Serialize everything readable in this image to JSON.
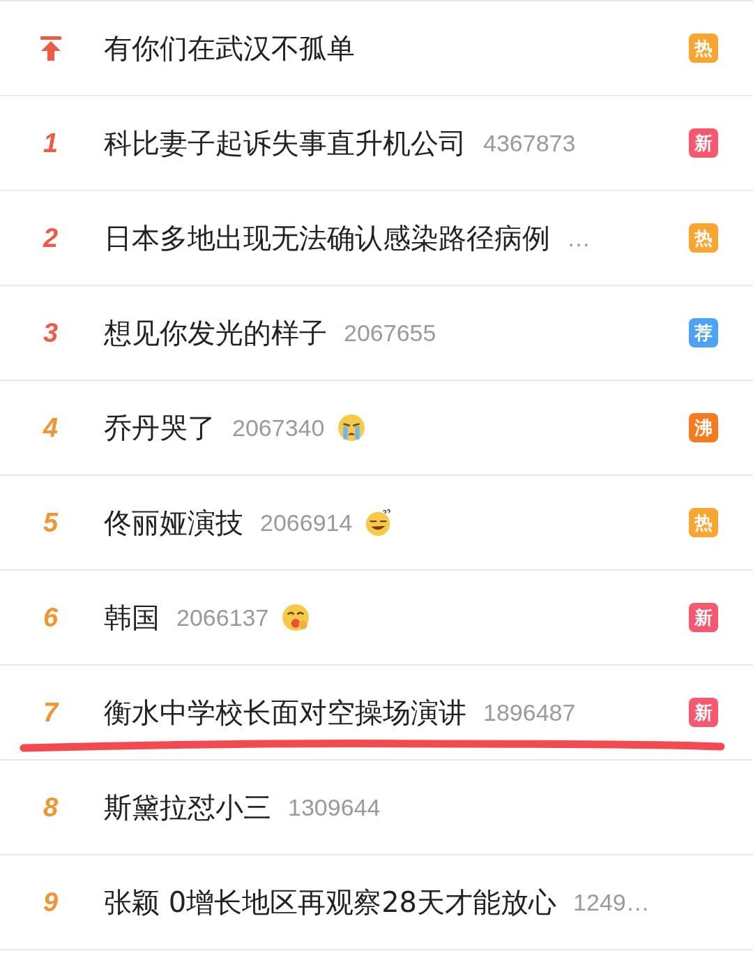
{
  "hot_list": [
    {
      "kind": "pinned",
      "title": "有你们在武汉不孤单",
      "badge": {
        "label": "热",
        "color": "#f9a531"
      }
    },
    {
      "kind": "ranked",
      "rank": "1",
      "color": "#ee5a46",
      "title": "科比妻子起诉失事直升机公司",
      "count": "4367873",
      "badge": {
        "label": "新",
        "color": "#f5596f"
      }
    },
    {
      "kind": "ranked",
      "rank": "2",
      "color": "#ee5a46",
      "title": "日本多地出现无法确认感染路径病例",
      "count": "…",
      "badge": {
        "label": "热",
        "color": "#f9a531"
      }
    },
    {
      "kind": "ranked",
      "rank": "3",
      "color": "#ee5a46",
      "title": "想见你发光的样子",
      "count": "2067655",
      "badge": {
        "label": "荐",
        "color": "#4ea2f5"
      }
    },
    {
      "kind": "ranked",
      "rank": "4",
      "color": "#f19532",
      "title": "乔丹哭了",
      "count": "2067340",
      "emoji": {
        "kind": "crying"
      },
      "badge": {
        "label": "沸",
        "color": "#f67a1f"
      }
    },
    {
      "kind": "ranked",
      "rank": "5",
      "color": "#f19532",
      "title": "佟丽娅演技",
      "count": "2066914",
      "emoji": {
        "kind": "dizzy"
      },
      "badge": {
        "label": "热",
        "color": "#f9a531"
      }
    },
    {
      "kind": "ranked",
      "rank": "6",
      "color": "#f19532",
      "title": "韩国",
      "count": "2066137",
      "emoji": {
        "kind": "yum"
      },
      "badge": {
        "label": "新",
        "color": "#f5596f"
      }
    },
    {
      "kind": "ranked",
      "rank": "7",
      "color": "#f19532",
      "title": "衡水中学校长面对空操场演讲",
      "count": "1896487",
      "badge": {
        "label": "新",
        "color": "#f5596f"
      },
      "underlined": true
    },
    {
      "kind": "ranked",
      "rank": "8",
      "color": "#f19532",
      "title": "斯黛拉怼小三",
      "count": "1309644"
    },
    {
      "kind": "ranked",
      "rank": "9",
      "color": "#f19532",
      "title": "张颖 0增长地区再观察28天才能放心",
      "count": "1249…"
    }
  ]
}
